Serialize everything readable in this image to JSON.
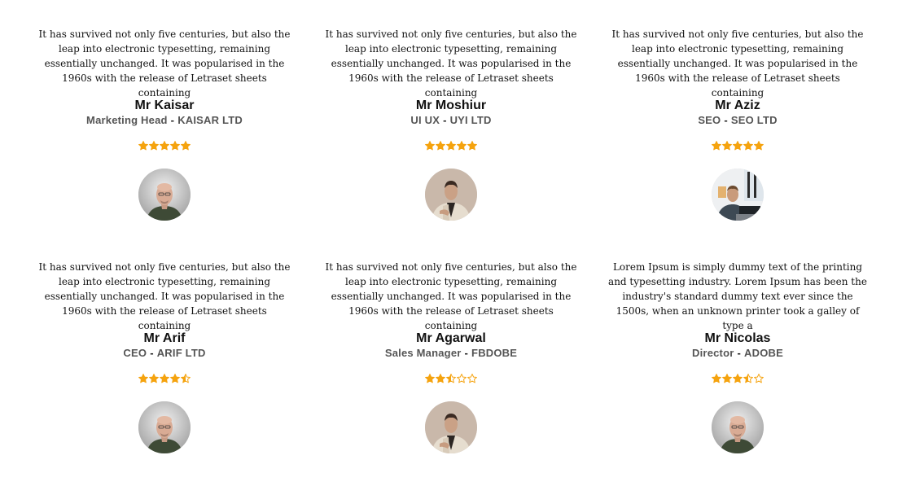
{
  "testimonials": [
    {
      "quote": "It has survived not only five centuries, but also the leap into electronic typesetting, remaining essentially unchanged. It was popularised in the 1960s with the release of Letraset sheets containing",
      "name": "Mr Kaisar",
      "role": "Marketing Head",
      "company": "KAISAR LTD",
      "rating": 5,
      "avatar": "bald-man-portrait"
    },
    {
      "quote": "It has survived not only five centuries, but also the leap into electronic typesetting, remaining essentially unchanged. It was popularised in the 1960s with the release of Letraset sheets containing",
      "name": "Mr Moshiur",
      "role": "UI UX",
      "company": "UYI LTD",
      "rating": 5,
      "avatar": "man-in-beige-suit-portrait"
    },
    {
      "quote": "It has survived not only five centuries, but also the leap into electronic typesetting, remaining essentially unchanged. It was popularised in the 1960s with the release of Letraset sheets containing",
      "name": "Mr Aziz",
      "role": "SEO",
      "company": "SEO LTD",
      "rating": 5,
      "avatar": "man-at-desk-portrait"
    },
    {
      "quote": "It has survived not only five centuries, but also the leap into electronic typesetting, remaining essentially unchanged. It was popularised in the 1960s with the release of Letraset sheets containing",
      "name": "Mr Arif",
      "role": "CEO",
      "company": "ARIF LTD",
      "rating": 4.5,
      "avatar": "bald-man-portrait"
    },
    {
      "quote": "It has survived not only five centuries, but also the leap into electronic typesetting, remaining essentially unchanged. It was popularised in the 1960s with the release of Letraset sheets containing",
      "name": "Mr Agarwal",
      "role": "Sales Manager",
      "company": "FBDOBE",
      "rating": 2.5,
      "avatar": "man-in-beige-suit-portrait"
    },
    {
      "quote": "Lorem Ipsum is simply dummy text of the printing and typesetting industry. Lorem Ipsum has been the industry's standard dummy text ever since the 1500s, when an unknown printer took a galley of type a",
      "name": "Mr Nicolas",
      "role": "Director",
      "company": "ADOBE",
      "rating": 3.5,
      "avatar": "bald-man-portrait"
    }
  ],
  "separator": "-",
  "colors": {
    "star": "#f5a30f",
    "name": "#111111",
    "role": "#555555"
  }
}
